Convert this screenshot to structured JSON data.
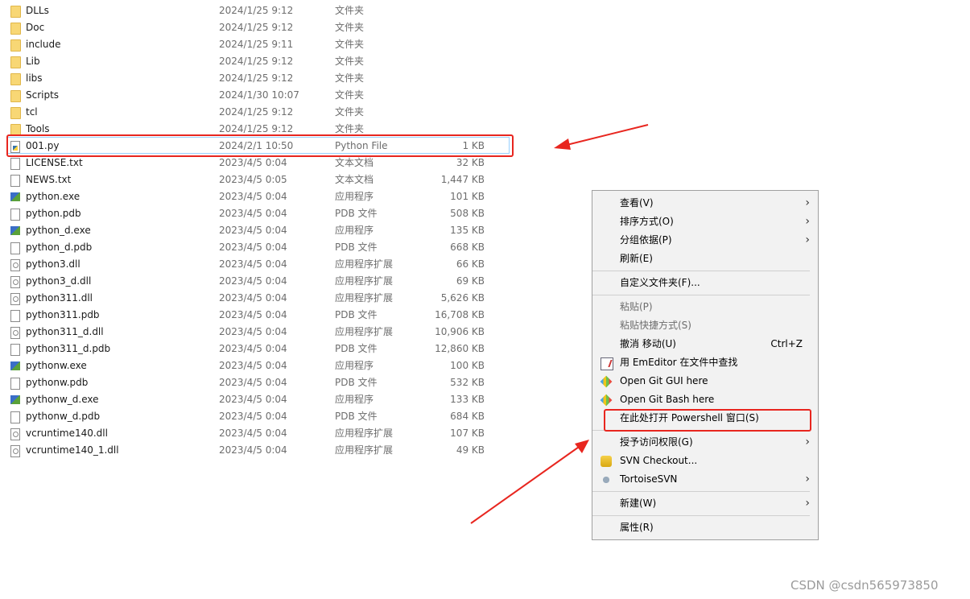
{
  "files": [
    {
      "name": "DLLs",
      "date": "2024/1/25 9:12",
      "type": "文件夹",
      "size": "",
      "icon": "folder"
    },
    {
      "name": "Doc",
      "date": "2024/1/25 9:12",
      "type": "文件夹",
      "size": "",
      "icon": "folder"
    },
    {
      "name": "include",
      "date": "2024/1/25 9:11",
      "type": "文件夹",
      "size": "",
      "icon": "folder"
    },
    {
      "name": "Lib",
      "date": "2024/1/25 9:12",
      "type": "文件夹",
      "size": "",
      "icon": "folder"
    },
    {
      "name": "libs",
      "date": "2024/1/25 9:12",
      "type": "文件夹",
      "size": "",
      "icon": "folder"
    },
    {
      "name": "Scripts",
      "date": "2024/1/30 10:07",
      "type": "文件夹",
      "size": "",
      "icon": "folder"
    },
    {
      "name": "tcl",
      "date": "2024/1/25 9:12",
      "type": "文件夹",
      "size": "",
      "icon": "folder"
    },
    {
      "name": "Tools",
      "date": "2024/1/25 9:12",
      "type": "文件夹",
      "size": "",
      "icon": "folder"
    },
    {
      "name": "001.py",
      "date": "2024/2/1 10:50",
      "type": "Python File",
      "size": "1 KB",
      "icon": "py"
    },
    {
      "name": "LICENSE.txt",
      "date": "2023/4/5 0:04",
      "type": "文本文档",
      "size": "32 KB",
      "icon": "doc"
    },
    {
      "name": "NEWS.txt",
      "date": "2023/4/5 0:05",
      "type": "文本文档",
      "size": "1,447 KB",
      "icon": "doc"
    },
    {
      "name": "python.exe",
      "date": "2023/4/5 0:04",
      "type": "应用程序",
      "size": "101 KB",
      "icon": "exe"
    },
    {
      "name": "python.pdb",
      "date": "2023/4/5 0:04",
      "type": "PDB 文件",
      "size": "508 KB",
      "icon": "doc"
    },
    {
      "name": "python_d.exe",
      "date": "2023/4/5 0:04",
      "type": "应用程序",
      "size": "135 KB",
      "icon": "exe"
    },
    {
      "name": "python_d.pdb",
      "date": "2023/4/5 0:04",
      "type": "PDB 文件",
      "size": "668 KB",
      "icon": "doc"
    },
    {
      "name": "python3.dll",
      "date": "2023/4/5 0:04",
      "type": "应用程序扩展",
      "size": "66 KB",
      "icon": "dll"
    },
    {
      "name": "python3_d.dll",
      "date": "2023/4/5 0:04",
      "type": "应用程序扩展",
      "size": "69 KB",
      "icon": "dll"
    },
    {
      "name": "python311.dll",
      "date": "2023/4/5 0:04",
      "type": "应用程序扩展",
      "size": "5,626 KB",
      "icon": "dll"
    },
    {
      "name": "python311.pdb",
      "date": "2023/4/5 0:04",
      "type": "PDB 文件",
      "size": "16,708 KB",
      "icon": "doc"
    },
    {
      "name": "python311_d.dll",
      "date": "2023/4/5 0:04",
      "type": "应用程序扩展",
      "size": "10,906 KB",
      "icon": "dll"
    },
    {
      "name": "python311_d.pdb",
      "date": "2023/4/5 0:04",
      "type": "PDB 文件",
      "size": "12,860 KB",
      "icon": "doc"
    },
    {
      "name": "pythonw.exe",
      "date": "2023/4/5 0:04",
      "type": "应用程序",
      "size": "100 KB",
      "icon": "exe"
    },
    {
      "name": "pythonw.pdb",
      "date": "2023/4/5 0:04",
      "type": "PDB 文件",
      "size": "532 KB",
      "icon": "doc"
    },
    {
      "name": "pythonw_d.exe",
      "date": "2023/4/5 0:04",
      "type": "应用程序",
      "size": "133 KB",
      "icon": "exe"
    },
    {
      "name": "pythonw_d.pdb",
      "date": "2023/4/5 0:04",
      "type": "PDB 文件",
      "size": "684 KB",
      "icon": "doc"
    },
    {
      "name": "vcruntime140.dll",
      "date": "2023/4/5 0:04",
      "type": "应用程序扩展",
      "size": "107 KB",
      "icon": "dll"
    },
    {
      "name": "vcruntime140_1.dll",
      "date": "2023/4/5 0:04",
      "type": "应用程序扩展",
      "size": "49 KB",
      "icon": "dll"
    }
  ],
  "context_menu": [
    {
      "label": "查看(V)",
      "submenu": true
    },
    {
      "label": "排序方式(O)",
      "submenu": true
    },
    {
      "label": "分组依据(P)",
      "submenu": true
    },
    {
      "label": "刷新(E)"
    },
    {
      "separator": true
    },
    {
      "label": "自定义文件夹(F)..."
    },
    {
      "separator": true
    },
    {
      "label": "粘贴(P)",
      "disabled": true
    },
    {
      "label": "粘贴快捷方式(S)",
      "disabled": true
    },
    {
      "label": "撤消 移动(U)",
      "shortcut": "Ctrl+Z"
    },
    {
      "label": "用 EmEditor 在文件中查找",
      "icon": "emeditor"
    },
    {
      "label": "Open Git GUI here",
      "icon": "git"
    },
    {
      "label": "Open Git Bash here",
      "icon": "git"
    },
    {
      "label": "在此处打开 Powershell 窗口(S)",
      "highlighted": true
    },
    {
      "separator": true
    },
    {
      "label": "授予访问权限(G)",
      "submenu": true
    },
    {
      "label": "SVN Checkout...",
      "icon": "svn"
    },
    {
      "label": "TortoiseSVN",
      "icon": "tortoisesvn",
      "submenu": true
    },
    {
      "separator": true
    },
    {
      "label": "新建(W)",
      "submenu": true
    },
    {
      "separator": true
    },
    {
      "label": "属性(R)"
    }
  ],
  "annotation_color": "#e8261f",
  "watermark": "CSDN @csdn565973850"
}
